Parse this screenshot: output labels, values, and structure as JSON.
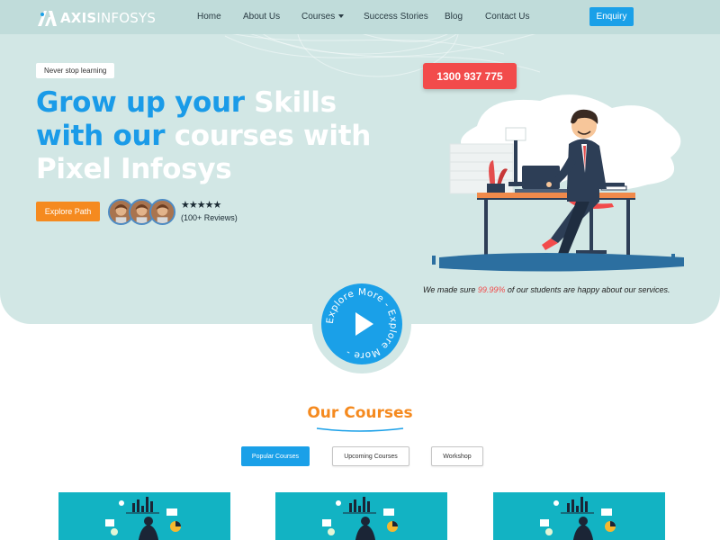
{
  "logo": {
    "brand_bold": "AXIS",
    "brand_light": "INFOSYS"
  },
  "nav": {
    "items": [
      {
        "label": "Home"
      },
      {
        "label": "About Us"
      },
      {
        "label": "Courses"
      },
      {
        "label": "Success Stories"
      },
      {
        "label": "Blog"
      },
      {
        "label": "Contact Us"
      }
    ],
    "cta_label": "Enquiry"
  },
  "hero": {
    "tag": "Never stop learning",
    "headline": {
      "line1_a": "Grow up your ",
      "line1_b": "Skills",
      "line2_a": "with our ",
      "line2_b": "courses with",
      "line3": "Pixel Infosys"
    },
    "cta_label": "Explore Path",
    "rating_stars": "★★★★★",
    "rating": 4.5,
    "reviews": "(100+ Reviews)",
    "phone": "1300 937 775",
    "note_before": "We made sure ",
    "note_highlight": "99.99%",
    "note_after": " of our students are happy about our services.",
    "explore_more_text": "Explore More - Explore More - "
  },
  "courses": {
    "title": "Our Courses",
    "tabs": [
      {
        "label": "Popular Courses",
        "active": true
      },
      {
        "label": "Upcoming Courses",
        "active": false
      },
      {
        "label": "Workshop",
        "active": false
      }
    ],
    "cards_count": 3
  },
  "colors": {
    "accent_blue": "#1aa0e8",
    "accent_orange": "#f58a1f",
    "accent_red": "#f24b4b",
    "hero_bg": "#d2e7e5",
    "card_teal": "#12b3c3"
  },
  "icons": [
    "play-icon",
    "star-icon",
    "caret-down-icon"
  ]
}
